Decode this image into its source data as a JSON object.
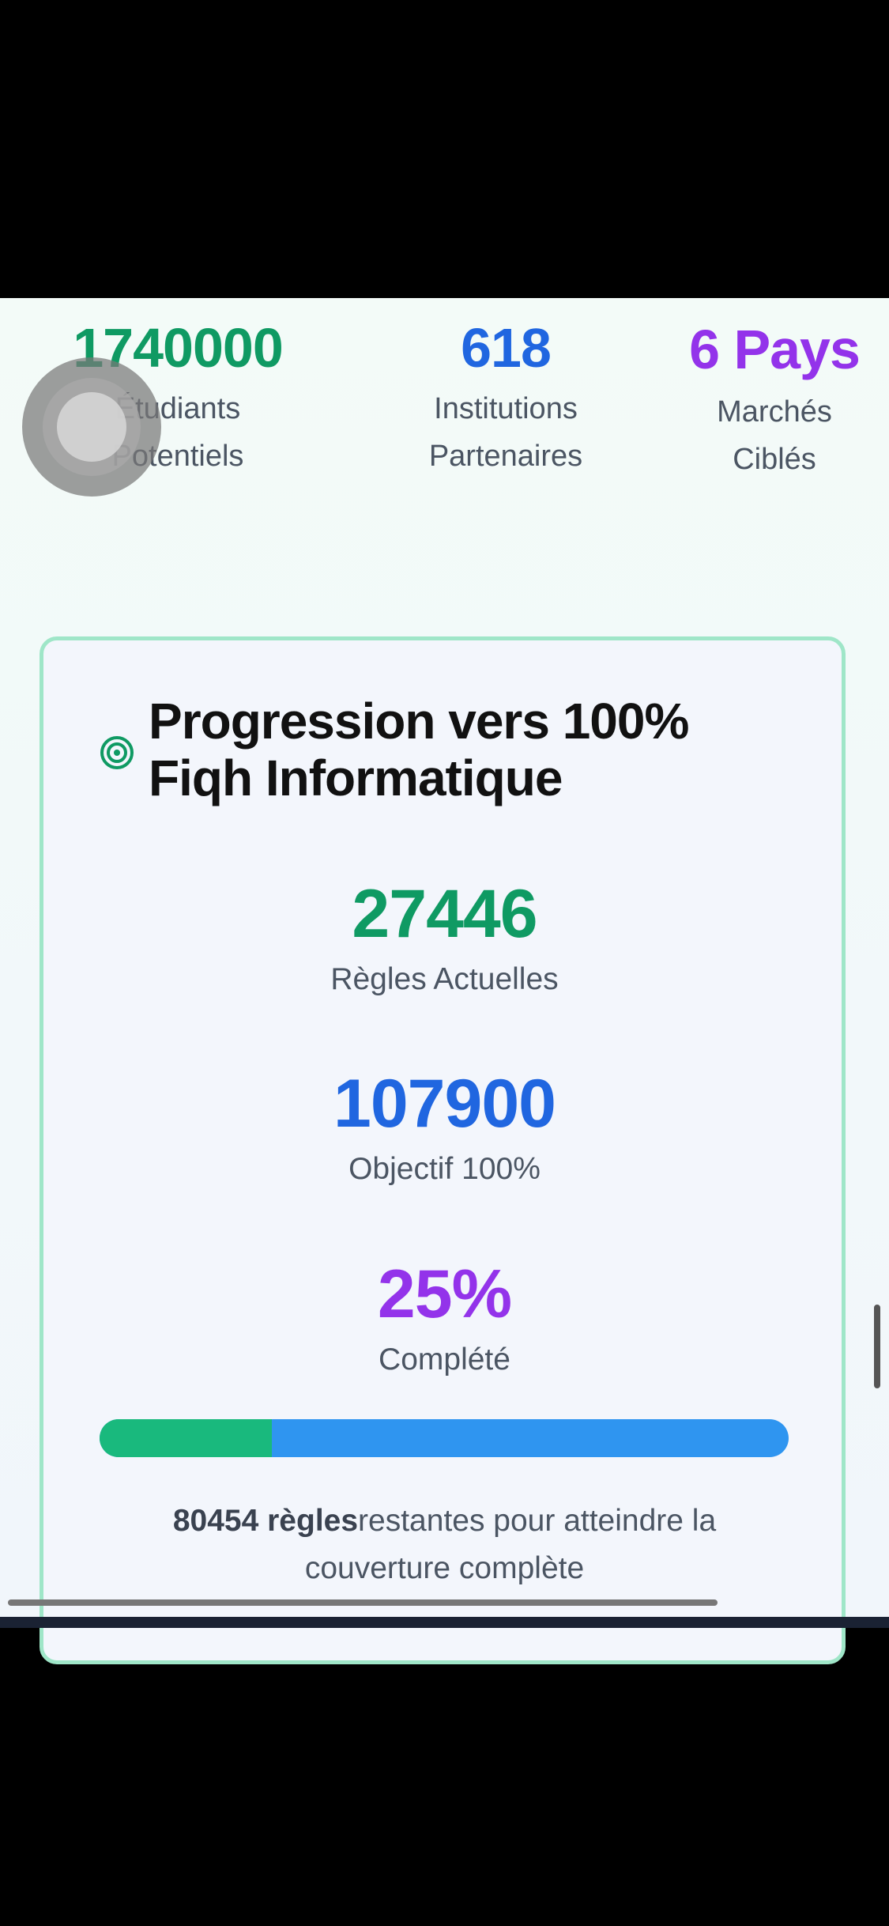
{
  "stats": [
    {
      "value": "1740000",
      "label": "Étudiants Potentiels"
    },
    {
      "value": "618",
      "label": "Institutions Partenaires"
    },
    {
      "value": "6 Pays",
      "label": "Marchés Ciblés"
    }
  ],
  "progress_card": {
    "title": "Progression vers 100% Fiqh Informatique",
    "current": {
      "value": "27446",
      "label": "Règles Actuelles"
    },
    "target": {
      "value": "107900",
      "label": "Objectif 100%"
    },
    "percent": {
      "value": "25%",
      "label": "Complété"
    },
    "progress_fraction": 0.25,
    "remaining_bold": "80454 règles",
    "remaining_text": "restantes pour atteindre la couverture complète"
  },
  "colors": {
    "green": "#0f9a63",
    "blue": "#2066e0",
    "purple": "#9333ea",
    "progress_fill": "#19b97d",
    "progress_track": "#2f95f0",
    "card_border": "#9fe6c8"
  },
  "icons": {
    "card_icon": "target-icon",
    "floating_button": "assistive-touch-icon"
  }
}
